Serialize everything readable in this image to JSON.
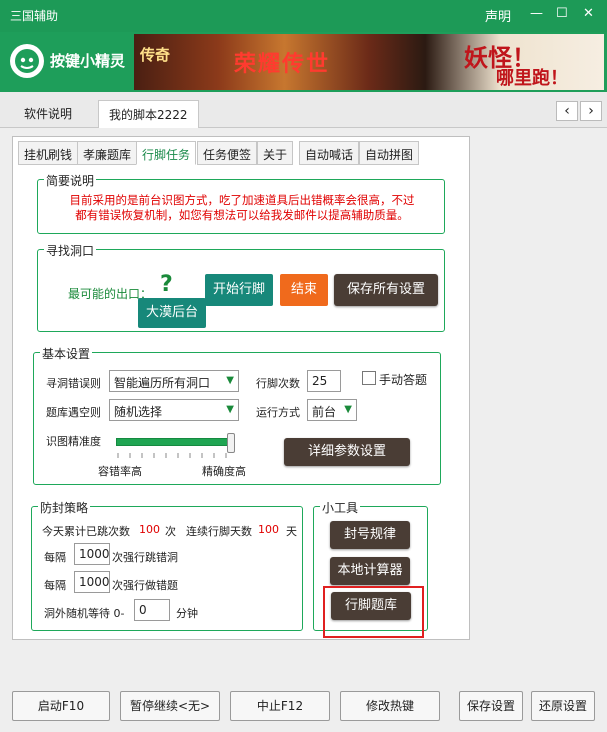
{
  "window": {
    "title": "三国辅助",
    "statement": "声明",
    "minimize": "—",
    "maximize": "☐",
    "close": "✕"
  },
  "header": {
    "logo_text": "按键小精灵",
    "banner": {
      "left_text": "传奇",
      "mid_text": "荣耀传世",
      "right_text": "妖怪！",
      "right_text2": "哪里跑！"
    }
  },
  "top_tabs": [
    "软件说明",
    "我的脚本2222"
  ],
  "nav": {
    "prev": "‹",
    "next": "›"
  },
  "sub_tabs": [
    "挂机刷钱",
    "孝廉题库",
    "行脚任务",
    "任务便签",
    "关于",
    "自动喊话",
    "自动拼图"
  ],
  "summary": {
    "legend": "简要说明",
    "line1": "目前采用的是前台识图方式，吃了加速道具后出错概率会很高，不过",
    "line2": "都有错误恢复机制，如您有想法可以给我发邮件以提高辅助质量。"
  },
  "find_hole": {
    "legend": "寻找洞口",
    "exit_label": "最可能的出口：",
    "exit_value": "大漠后台",
    "question_icon": "?",
    "start_button": "开始行脚",
    "stop_button": "结束",
    "save_all_button": "保存所有设置"
  },
  "basic": {
    "legend": "基本设置",
    "error_rule_label": "寻洞错误则",
    "error_rule_value": "智能遍历所有洞口",
    "count_label": "行脚次数",
    "count_value": "25",
    "manual_answer_label": "手动答题",
    "bank_empty_label": "题库遇空则",
    "bank_empty_value": "随机选择",
    "run_mode_label": "运行方式",
    "run_mode_value": "前台",
    "precision_label": "识图精准度",
    "tolerance_label": "容错率高",
    "accuracy_label": "精确度高",
    "precision_value": 0.98,
    "detail_button": "详细参数设置"
  },
  "anti_ban": {
    "legend": "防封策略",
    "today_skip_prefix": "今天累计已跳次数",
    "today_skip_value": "100",
    "today_skip_unit": "次",
    "consecutive_prefix": "连续行脚天数",
    "consecutive_value": "100",
    "consecutive_unit": "天",
    "every1_prefix": "每隔",
    "every1_value": "1000",
    "every1_suffix": "次强行跳错洞",
    "every2_prefix": "每隔",
    "every2_value": "1000",
    "every2_suffix": "次强行做错题",
    "wait_prefix": "洞外随机等待 0-",
    "wait_value": "0",
    "wait_suffix": "分钟"
  },
  "tools": {
    "legend": "小工具",
    "ban_rule_button": "封号规律",
    "calculator_button": "本地计算器",
    "question_bank_button": "行脚题库"
  },
  "bottom": {
    "start": "启动F10",
    "pause": "暂停继续<无>",
    "stop": "中止F12",
    "hotkey": "修改热键",
    "save": "保存设置",
    "restore": "还原设置"
  },
  "colors": {
    "brand_green": "#1e9e5a",
    "group_border": "#1ea85a",
    "highlight_red": "#e02020",
    "teal_button": "#17887a",
    "orange_button": "#f06a1c",
    "dark_button": "#4a3d35"
  }
}
